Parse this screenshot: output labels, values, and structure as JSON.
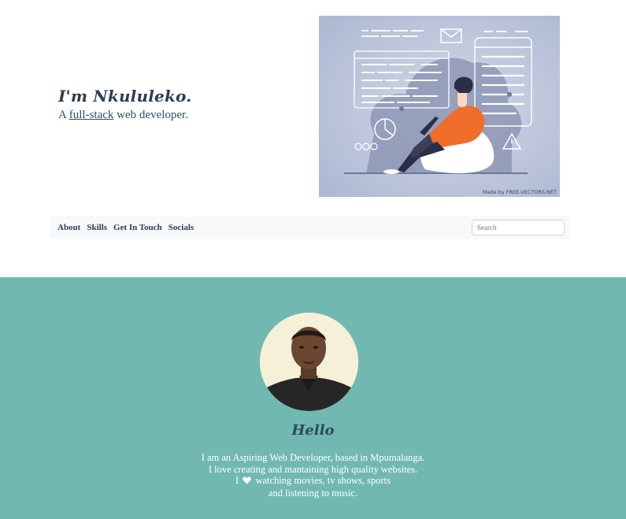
{
  "hero": {
    "title": "I'm Nkululeko.",
    "subtitle_prefix": "A ",
    "subtitle_link": "full-stack",
    "subtitle_suffix": " web developer.",
    "illustration_credit": "Made by FREE-VECTORS.NET"
  },
  "navbar": {
    "links": [
      "About",
      "Skills",
      "Get In Touch",
      "Socials"
    ],
    "search_placeholder": "Search"
  },
  "about": {
    "heading": "Hello",
    "bio_line_1": "I am an Aspiring Web Developer, based in Mpumalanga.",
    "bio_line_2": "I love creating and mantaining high quality websites.",
    "bio_line_3_prefix": "I",
    "bio_line_3_suffix": "watching movies, tv shows, sports",
    "bio_line_4": "and listening to music."
  },
  "colors": {
    "about_background": "#71b9b0",
    "illustration_background": "#b8c2d8",
    "accent_orange": "#f06d2a",
    "heading_text": "#2c3e50"
  },
  "icons": [
    "envelope-icon",
    "pie-chart-icon",
    "warning-icon",
    "heart-icon"
  ]
}
